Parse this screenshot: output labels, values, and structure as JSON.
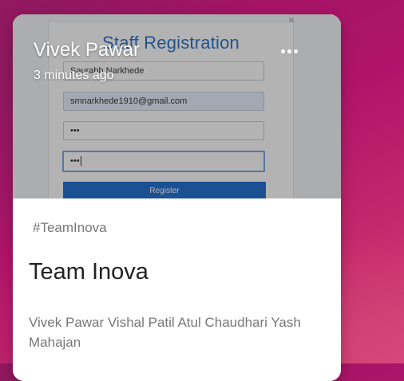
{
  "post": {
    "author": "Vivek Pawar",
    "time": "3 minutes ago",
    "hashtag": "#TeamInova",
    "title": "Team Inova",
    "body": "Vivek Pawar Vishal Patil Atul Chaudhari Yash Mahajan",
    "more_icon": "more-horizontal-icon"
  },
  "screenshot": {
    "title": "Staff Registration",
    "close_glyph": "×",
    "name_value": "Saurabh Narkhede",
    "email_value": "smnarkhede1910@gmail.com",
    "password_value": "•••",
    "confirm_password_value": "•••",
    "button_label": "Register"
  },
  "colors": {
    "background_start": "#9a1463",
    "background_end": "#d23e72",
    "register_button": "#1f6fd0",
    "form_title": "#2b72c7"
  }
}
